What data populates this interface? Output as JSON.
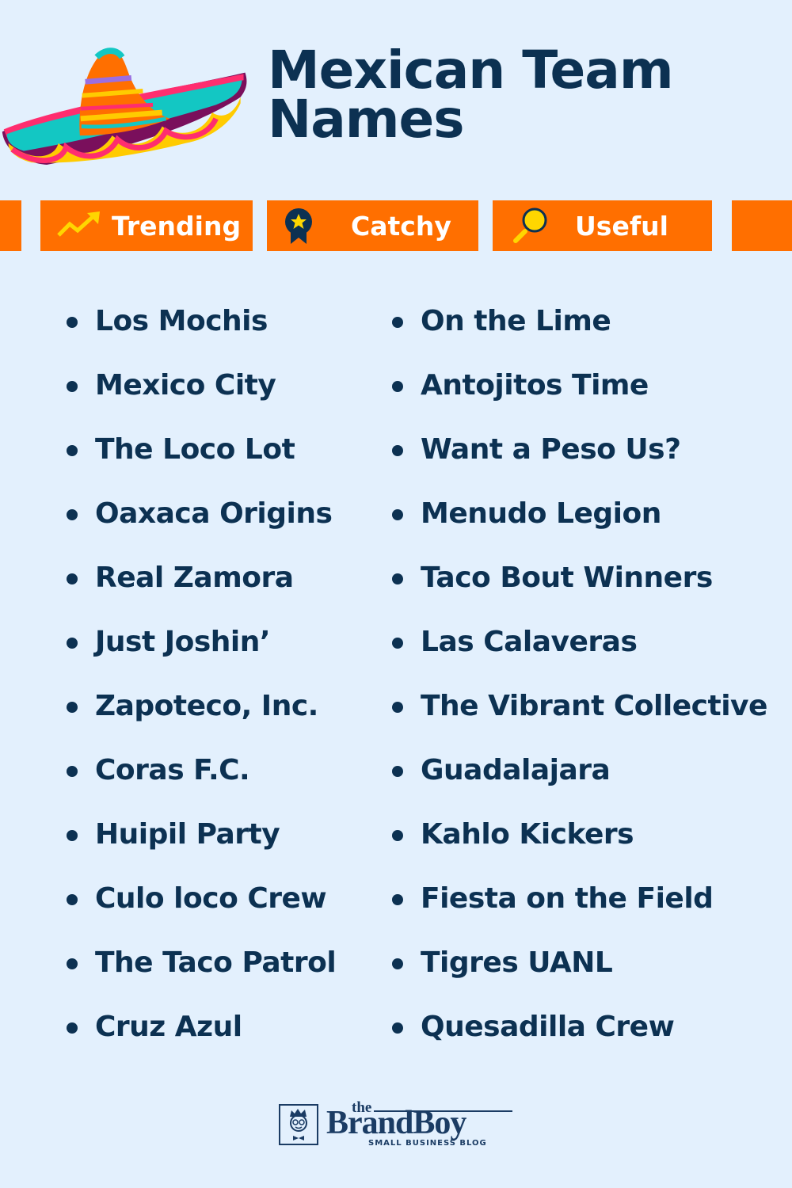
{
  "header": {
    "title_line1": "Mexican Team",
    "title_line2": "Names"
  },
  "tags": [
    {
      "label": "Trending",
      "icon": "trending-up-icon"
    },
    {
      "label": "Catchy",
      "icon": "award-ribbon-icon"
    },
    {
      "label": "Useful",
      "icon": "magnifier-icon"
    }
  ],
  "colors": {
    "background": "#e3f0fd",
    "text": "#0c3152",
    "tag_background": "#ff6f00",
    "tag_text": "#ffffff",
    "icon_yellow": "#ffd600"
  },
  "names": {
    "left": [
      "Los Mochis",
      "Mexico City",
      "The Loco Lot",
      "Oaxaca Origins",
      "Real Zamora",
      "Just Joshin’",
      "Zapoteco, Inc.",
      "Coras F.C.",
      "Huipil Party",
      "Culo loco Crew",
      "The Taco Patrol",
      "Cruz Azul"
    ],
    "right": [
      "On the Lime",
      "Antojitos Time",
      "Want a Peso Us?",
      "Menudo Legion",
      "Taco Bout Winners",
      "Las Calaveras",
      "The Vibrant Collective",
      "Guadalajara",
      "Kahlo Kickers",
      "Fiesta on the Field",
      "Tigres UANL",
      "Quesadilla Crew"
    ]
  },
  "footer": {
    "logo_the": "the",
    "logo_brand": "BrandBoy",
    "logo_tagline": "SMALL BUSINESS BLOG"
  }
}
